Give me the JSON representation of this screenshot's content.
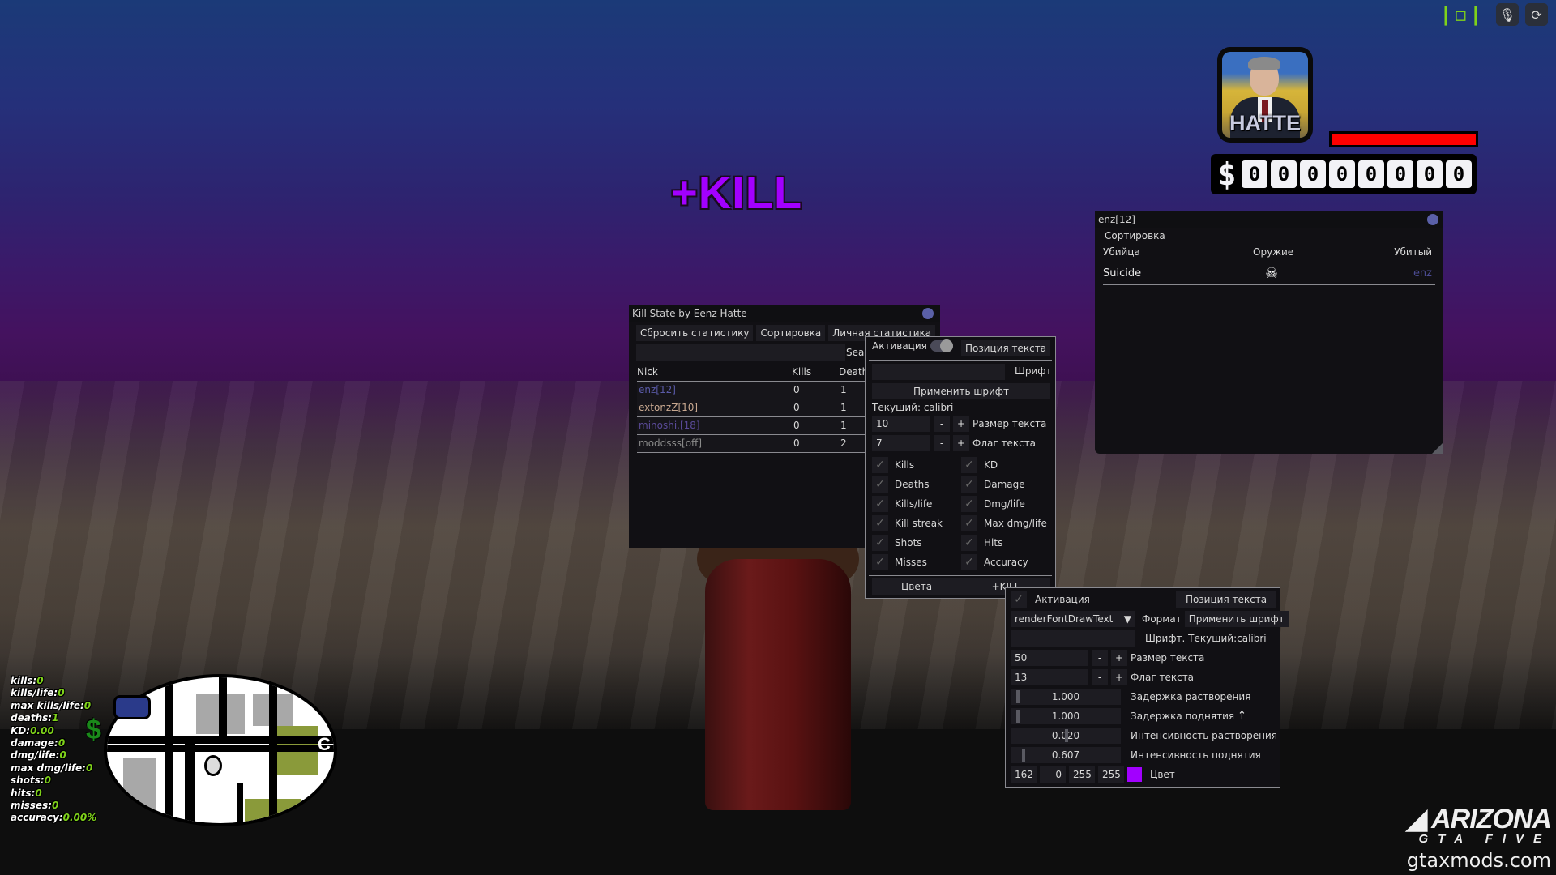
{
  "hud": {
    "network_indicator": "|◻|",
    "mic_icon": "🎙",
    "refresh_icon": "⟳",
    "player_name": "HATTE",
    "health_fraction": 1.0,
    "money_symbol": "$",
    "money_digits": [
      "0",
      "0",
      "0",
      "0",
      "0",
      "0",
      "0",
      "0"
    ],
    "health_color": "#ff0000"
  },
  "kill_popup": {
    "text": "+KILL",
    "color": "#a200ff"
  },
  "kill_state_window": {
    "title": "Kill State by Eenz Hatte",
    "buttons": [
      "Сбросить статистику",
      "Сортировка",
      "Личная статистика"
    ],
    "search_placeholder": "",
    "search_label": "Search",
    "columns": [
      "Nick",
      "Kills",
      "Deaths"
    ],
    "rows": [
      {
        "nick": "enz[12]",
        "kills": "0",
        "deaths": "1",
        "color": "#5a5aa8"
      },
      {
        "nick": "extonzZ[10]",
        "kills": "0",
        "deaths": "1",
        "color": "#c8a890"
      },
      {
        "nick": "minoshi.[18]",
        "kills": "0",
        "deaths": "1",
        "color": "#5a4a98"
      },
      {
        "nick": "moddsss[off]",
        "kills": "0",
        "deaths": "2",
        "color": "#8a8a8a"
      }
    ]
  },
  "settings_window": {
    "activation_label": "Активация",
    "activation_on": true,
    "position_button": "Позиция текста",
    "font_input": "",
    "font_label": "Шрифт",
    "apply_font_button": "Применить шрифт",
    "current_font": "Текущий: calibri",
    "text_size": {
      "value": "10",
      "minus": "-",
      "plus": "+",
      "label": "Размер текста"
    },
    "text_flag": {
      "value": "7",
      "minus": "-",
      "plus": "+",
      "label": "Флаг текста"
    },
    "checkboxes": [
      {
        "label": "Kills",
        "checked": true
      },
      {
        "label": "KD",
        "checked": true
      },
      {
        "label": "Deaths",
        "checked": true
      },
      {
        "label": "Damage",
        "checked": true
      },
      {
        "label": "Kills/life",
        "checked": true
      },
      {
        "label": "Dmg/life",
        "checked": true
      },
      {
        "label": "Kill streak",
        "checked": true
      },
      {
        "label": "Max dmg/life",
        "checked": true
      },
      {
        "label": "Shots",
        "checked": true
      },
      {
        "label": "Hits",
        "checked": true
      },
      {
        "label": "Misses",
        "checked": true
      },
      {
        "label": "Accuracy",
        "checked": true
      }
    ],
    "check_glyph": "✓",
    "colors_button": "Цвета",
    "plus_kill_button": "+KILL"
  },
  "plus_kill_window": {
    "activation_label": "Активация",
    "check_glyph": "✓",
    "position_button": "Позиция текста",
    "format_select": "renderFontDrawText",
    "format_arrow": "▼",
    "format_label": "Формат",
    "apply_font_button": "Применить шрифт",
    "font_input": "",
    "font_current": "Шрифт. Текущий:calibri",
    "text_size": {
      "value": "50",
      "minus": "-",
      "plus": "+",
      "label": "Размер текста"
    },
    "text_flag": {
      "value": "13",
      "minus": "-",
      "plus": "+",
      "label": "Флаг текста"
    },
    "sliders": [
      {
        "value": "1.000",
        "label": "Задержка растворения",
        "fraction": 0.02
      },
      {
        "value": "1.000",
        "label": "Задержка поднятия",
        "fraction": 0.02
      },
      {
        "value": "0.020",
        "label": "Интенсивность растворения",
        "fraction": 0.5
      },
      {
        "value": "0.607",
        "label": "Интенсивность поднятия",
        "fraction": 0.08
      }
    ],
    "cursor_glyph": "↑",
    "color": {
      "r": "162",
      "g": "0",
      "b": "255",
      "a": "255",
      "label": "Цвет",
      "hex": "#a200ff"
    }
  },
  "kill_detail_window": {
    "title": "enz[12]",
    "sort_button": "Сортировка",
    "columns": [
      "Убийца",
      "Оружие",
      "Убитый"
    ],
    "rows": [
      {
        "killer": "Suicide",
        "weapon_icon": "☠",
        "victim": "enz"
      }
    ]
  },
  "stats_overlay": [
    {
      "label": "kills:",
      "value": "0"
    },
    {
      "label": "kills/life:",
      "value": "0"
    },
    {
      "label": "max kills/life:",
      "value": "0"
    },
    {
      "label": "deaths:",
      "value": "1"
    },
    {
      "label": "KD:",
      "value": "0.00"
    },
    {
      "label": "damage:",
      "value": "0"
    },
    {
      "label": "dmg/life:",
      "value": "0"
    },
    {
      "label": "max dmg/life:",
      "value": "0"
    },
    {
      "label": "shots:",
      "value": "0"
    },
    {
      "label": "hits:",
      "value": "0"
    },
    {
      "label": "misses:",
      "value": "0"
    },
    {
      "label": "accuracy:",
      "value": "0.00%"
    }
  ],
  "minimap": {
    "dollar_icon": "$",
    "compass_letter": "C"
  },
  "watermark": {
    "logo": "ARIZONA",
    "subtitle": "GTA FIVE",
    "site": "gtaxmods.com"
  }
}
